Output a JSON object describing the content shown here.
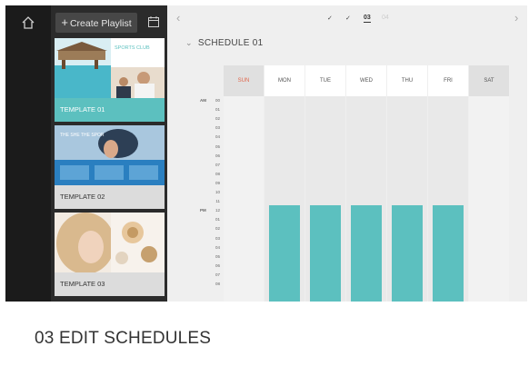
{
  "rail": {
    "home_icon": "home-icon"
  },
  "panel": {
    "create_label": "Create Playlist",
    "create_icon": "plus-icon",
    "side_icon": "calendar-icon",
    "templates": [
      {
        "label": "TEMPLATE 01",
        "thumb_text": "SPORTS CLUB",
        "selected": true
      },
      {
        "label": "TEMPLATE 02",
        "thumb_text": "THE SHE THE SPOR",
        "selected": false
      },
      {
        "label": "TEMPLATE 03",
        "selected": false
      }
    ]
  },
  "topbar": {
    "steps": [
      "✓",
      "✓"
    ],
    "current_step": "03",
    "next_step": "04",
    "prev_icon": "chevron-left-icon",
    "next_icon": "chevron-right-icon"
  },
  "schedule": {
    "title": "SCHEDULE 01",
    "days": [
      "SUN",
      "MON",
      "TUE",
      "WED",
      "THU",
      "FRI",
      "SAT"
    ],
    "active_days": [
      false,
      true,
      true,
      true,
      true,
      true,
      false
    ],
    "am_label": "AM",
    "pm_label": "PM",
    "hours": [
      "00",
      "01",
      "02",
      "03",
      "04",
      "05",
      "06",
      "07",
      "08",
      "09",
      "10",
      "11",
      "12",
      "01",
      "02",
      "03",
      "04",
      "05",
      "06",
      "07",
      "08"
    ]
  },
  "caption": "03 EDIT SCHEDULES",
  "colors": {
    "accent": "#5cc0bf",
    "sunday": "#e0664b",
    "dark": "#1b1b1b"
  }
}
